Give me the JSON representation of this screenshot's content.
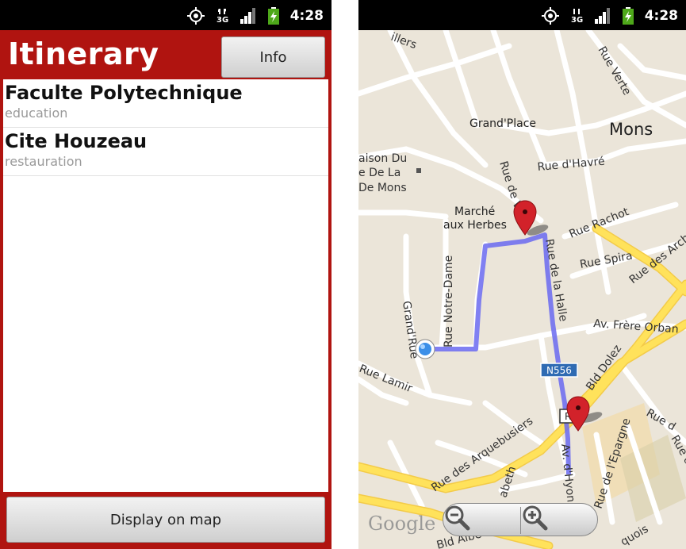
{
  "status_bar": {
    "time": "4:28",
    "icons": [
      "gps-icon",
      "3g-icon",
      "signal-icon",
      "battery-charging-icon"
    ]
  },
  "itinerary_app": {
    "title": "Itinerary",
    "info_button": "Info",
    "places": [
      {
        "name": "Faculte Polytechnique",
        "category": "education"
      },
      {
        "name": "Cite Houzeau",
        "category": "restauration"
      }
    ],
    "display_button": "Display on map",
    "colors": {
      "header": "#b01410",
      "list_bg": "#ffffff"
    }
  },
  "map": {
    "city_label": "Mons",
    "labels": {
      "grand_place": "Grand'Place",
      "rue_havre": "Rue d'Havré",
      "maison_1": "aison Du",
      "maison_2": "e De La",
      "maison_3": "De Mons",
      "marche_1": "Marché",
      "marche_2": "aux Herbes",
      "rue_de_la_halle": "Rue de la Halle",
      "rue_de_v": "Rue de V",
      "rue_rachot": "Rue Rachot",
      "rue_spira": "Rue Spira",
      "rue_notre_dame": "Rue Notre-Dame",
      "grand_rue": "Grand'Rue",
      "rue_verte": "Rue Verte",
      "rue_des_archers": "Rue des Arch",
      "av_frere_orban": "Av. Frère Orban",
      "bld_dolez": "Bld Dolez",
      "rue_lamir": "Rue Lamir",
      "rue_des_arquebusiers": "Rue des Arquebusiers",
      "rue_de_l_epargne": "Rue de l'Epargne",
      "av_hyon": "Av. d'Hyon",
      "elisabeth": "abeth",
      "bld_albert": "Bld Albe",
      "rue_top": "illers",
      "rue_right_bottom": "Rue d",
      "rue_right_bottom2": "quois",
      "rue_right_2": "Rue d",
      "road_badge_1": "N556",
      "road_badge_2": "R5"
    },
    "google_logo": "Google",
    "zoom_out": "zoom-out-icon",
    "zoom_in": "zoom-in-icon",
    "colors": {
      "route": "#6a6af0",
      "pin": "#d2222a",
      "major_road": "#ffe25b",
      "minor_road": "#ffffff"
    }
  }
}
